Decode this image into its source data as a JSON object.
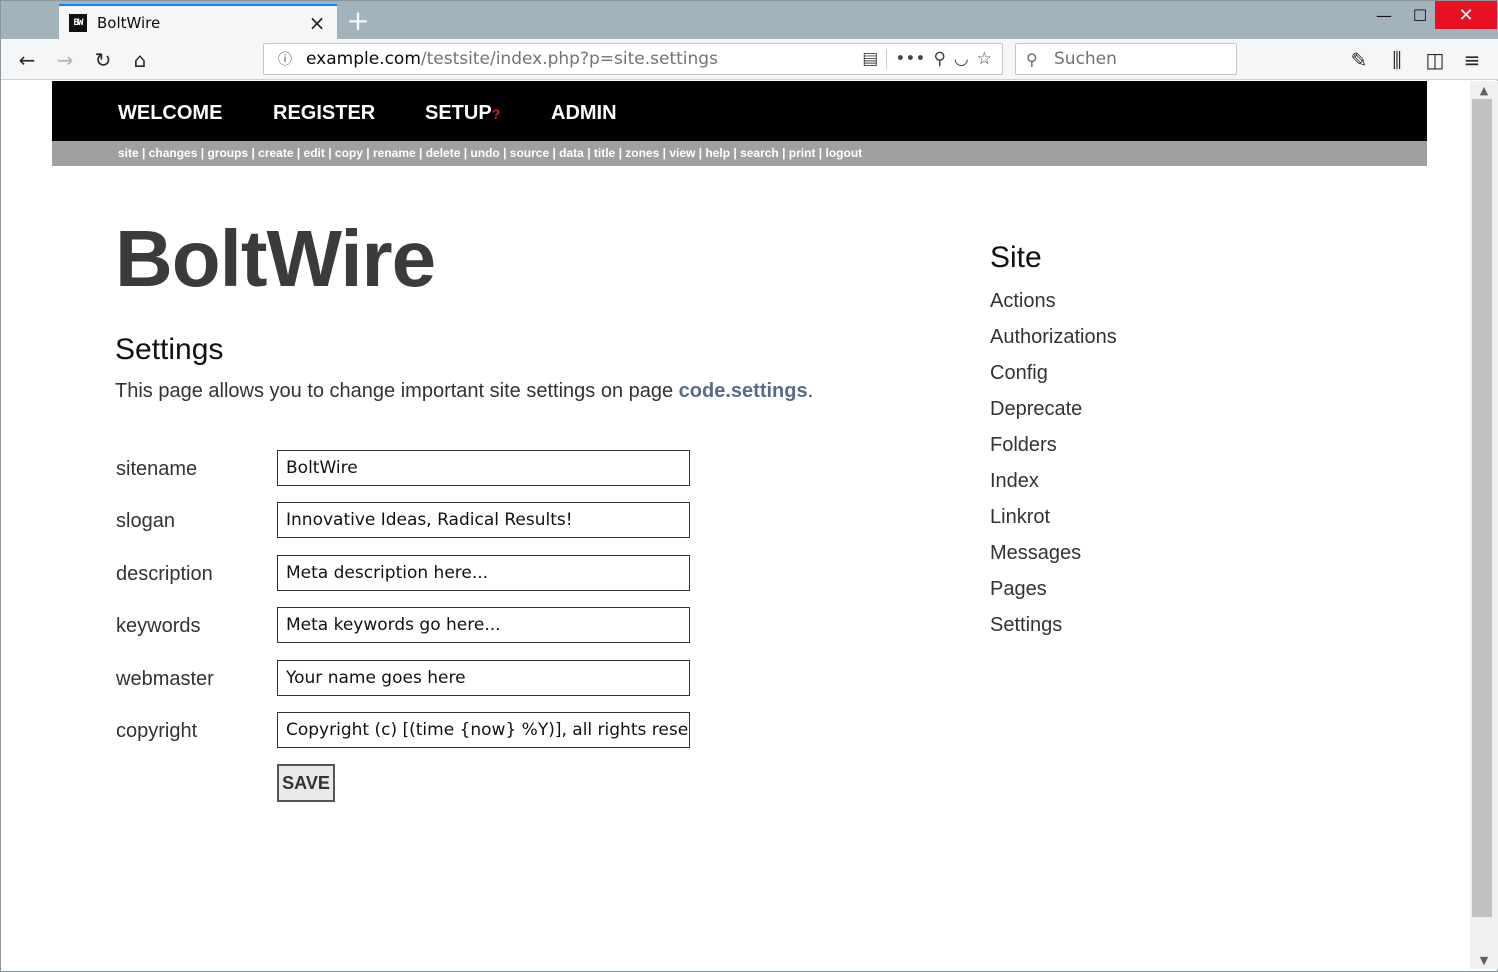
{
  "browser": {
    "tab_title": "BoltWire",
    "tab_favicon": "BW",
    "url_host": "example.com",
    "url_path": "/testsite/index.php?p=site.settings",
    "search_placeholder": "Suchen",
    "window_buttons": {
      "minimize": "—",
      "maximize": "☐",
      "close": "✕"
    }
  },
  "topmenu": {
    "items": [
      {
        "label": "WELCOME"
      },
      {
        "label": "REGISTER"
      },
      {
        "label": "SETUP",
        "badge": "?"
      },
      {
        "label": "ADMIN"
      }
    ]
  },
  "actionbar": {
    "links": [
      "site",
      "changes",
      "groups",
      "create",
      "edit",
      "copy",
      "rename",
      "delete",
      "undo",
      "source",
      "data",
      "title",
      "zones",
      "view",
      "help",
      "search",
      "print",
      "logout"
    ]
  },
  "page": {
    "brand": "BoltWire",
    "heading": "Settings",
    "intro_text": "This page allows you to change important site settings on page ",
    "intro_link": "code.settings",
    "intro_end": "."
  },
  "form": {
    "fields": [
      {
        "label": "sitename",
        "value": "BoltWire"
      },
      {
        "label": "slogan",
        "value": "Innovative Ideas, Radical Results!"
      },
      {
        "label": "description",
        "value": "Meta description here..."
      },
      {
        "label": "keywords",
        "value": "Meta keywords go here..."
      },
      {
        "label": "webmaster",
        "value": "Your name goes here"
      },
      {
        "label": "copyright",
        "value": "Copyright (c) [(time {now} %Y)], all rights reserved."
      }
    ],
    "save_label": "SAVE"
  },
  "sidebar": {
    "title": "Site",
    "items": [
      {
        "label": "Actions"
      },
      {
        "label": "Authorizations"
      },
      {
        "label": "Config"
      },
      {
        "label": "Deprecate"
      },
      {
        "label": "Folders"
      },
      {
        "label": "Index"
      },
      {
        "label": "Linkrot"
      },
      {
        "label": "Messages"
      },
      {
        "label": "Pages"
      },
      {
        "label": "Settings"
      }
    ]
  },
  "colors": {
    "tab_accent": "#0a84ff",
    "menu_bg": "#000000",
    "actionbar_bg": "#a0a0a0",
    "setup_badge": "#e21b1b",
    "link": "#5a6a8a"
  }
}
